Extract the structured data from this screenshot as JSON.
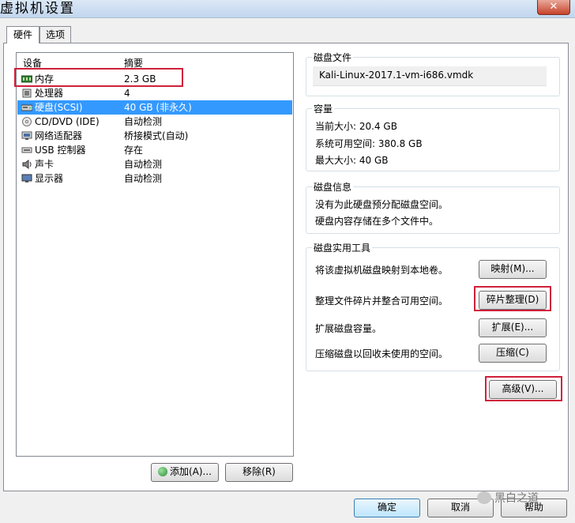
{
  "window": {
    "title": "虚拟机设置",
    "close_glyph": "✕"
  },
  "tabs": [
    {
      "label": "硬件",
      "active": true
    },
    {
      "label": "选项",
      "active": false
    }
  ],
  "device_list": {
    "headers": {
      "device": "设备",
      "summary": "摘要"
    },
    "rows": [
      {
        "name": "内存",
        "summary": "2.3 GB",
        "icon": "memory-icon"
      },
      {
        "name": "处理器",
        "summary": "4",
        "icon": "processor-icon"
      },
      {
        "name": "硬盘(SCSI)",
        "summary": "40 GB (非永久)",
        "icon": "hard-disk-icon",
        "selected": true
      },
      {
        "name": "CD/DVD (IDE)",
        "summary": "自动检测",
        "icon": "cd-dvd-icon"
      },
      {
        "name": "网络适配器",
        "summary": "桥接模式(自动)",
        "icon": "network-adapter-icon"
      },
      {
        "name": "USB 控制器",
        "summary": "存在",
        "icon": "usb-icon"
      },
      {
        "name": "声卡",
        "summary": "自动检测",
        "icon": "sound-card-icon"
      },
      {
        "name": "显示器",
        "summary": "自动检测",
        "icon": "display-icon"
      }
    ],
    "add_button": "添加(A)...",
    "remove_button": "移除(R)"
  },
  "disk_file": {
    "label": "磁盘文件",
    "value": "Kali-Linux-2017.1-vm-i686.vmdk"
  },
  "capacity": {
    "label": "容量",
    "current": "当前大小: 20.4 GB",
    "available": "系统可用空间: 380.8 GB",
    "max": "最大大小: 40 GB"
  },
  "disk_info": {
    "label": "磁盘信息",
    "line1": "没有为此硬盘预分配磁盘空间。",
    "line2": "硬盘内容存储在多个文件中。"
  },
  "utilities": {
    "label": "磁盘实用工具",
    "map_desc": "将该虚拟机磁盘映射到本地卷。",
    "map_button": "映射(M)...",
    "defrag_desc": "整理文件碎片并整合可用空间。",
    "defrag_button": "碎片整理(D)",
    "expand_desc": "扩展磁盘容量。",
    "expand_button": "扩展(E)...",
    "compact_desc": "压缩磁盘以回收未使用的空间。",
    "compact_button": "压缩(C)"
  },
  "advanced_button": "高级(V)...",
  "footer": {
    "ok": "确定",
    "cancel": "取消",
    "help": "帮助"
  },
  "watermark": "黑白之道",
  "colors": {
    "selection": "#3399ff",
    "highlight_box": "#d0203a"
  }
}
